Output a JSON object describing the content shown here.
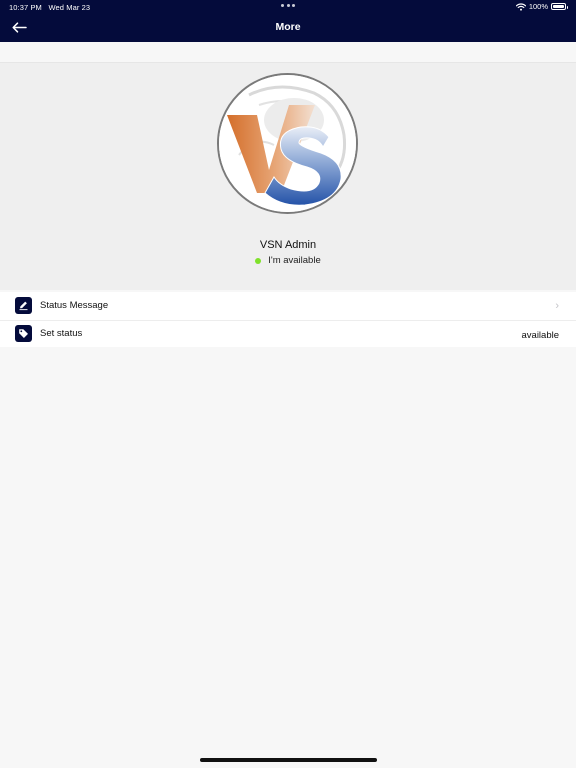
{
  "status_bar": {
    "time": "10:37 PM",
    "date": "Wed Mar 23",
    "battery": "100%",
    "wifi_icon": "wifi-icon",
    "battery_icon": "battery-icon"
  },
  "nav": {
    "title": "More",
    "back_icon": "arrow-left-icon"
  },
  "profile": {
    "name": "VSN Admin",
    "status_text": "I'm available",
    "status_color": "#7fe12a",
    "avatar_logo": "VS"
  },
  "settings": {
    "status_message": {
      "label": "Status Message",
      "icon": "edit-icon"
    },
    "set_status": {
      "label": "Set status",
      "value": "available",
      "icon": "tag-icon"
    }
  },
  "colors": {
    "nav_bg": "#040b3b",
    "page_bg": "#f7f7f7",
    "profile_bg": "#efefef",
    "logo_orange": "#d9742f",
    "logo_blue": "#2c5fb0"
  }
}
